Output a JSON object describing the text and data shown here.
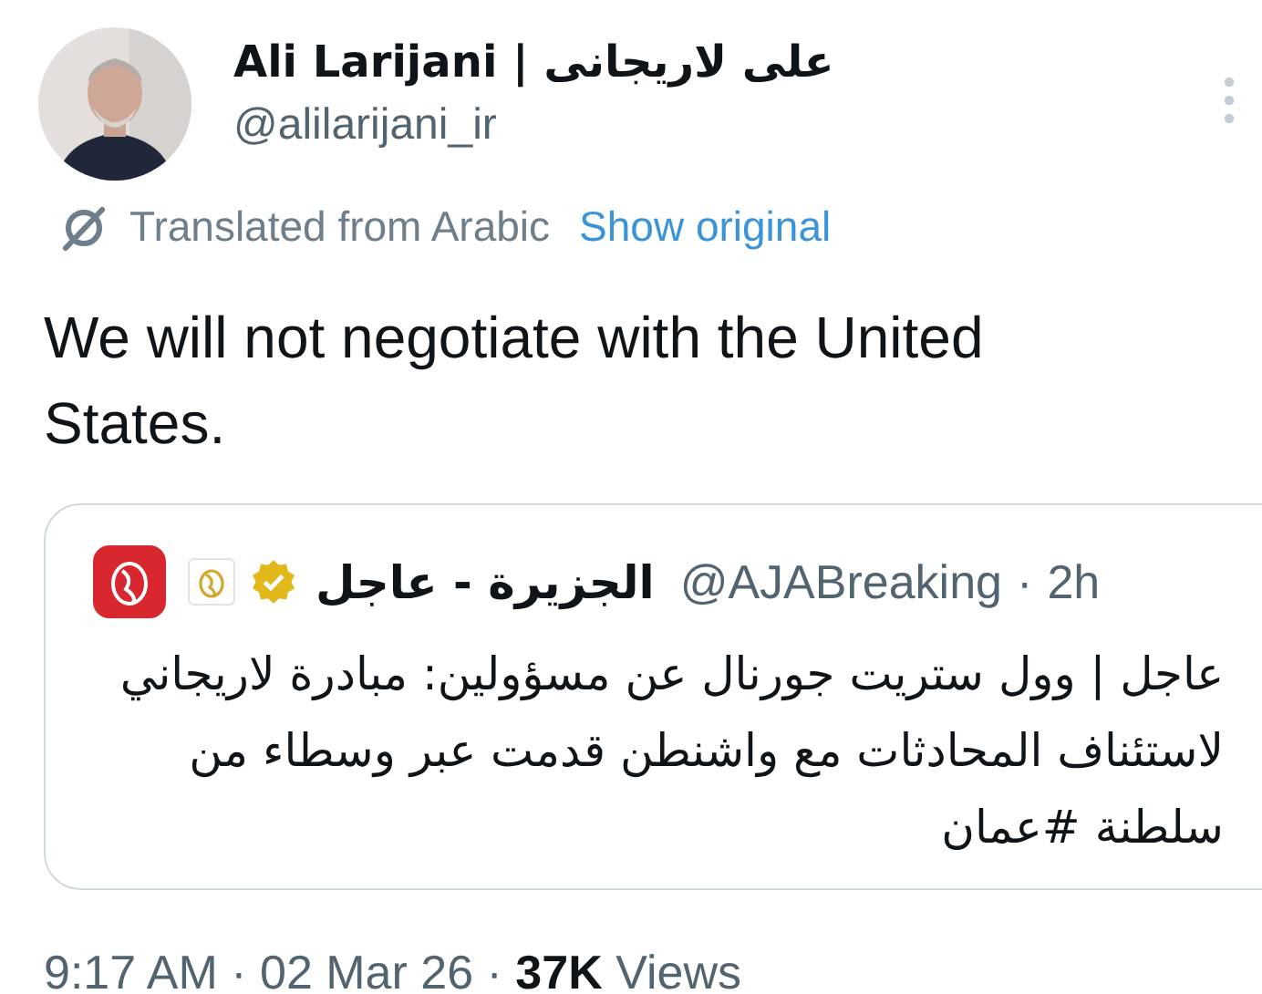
{
  "author": {
    "name": "Ali Larijani | علی لاریجانی",
    "handle": "@alilarijani_ir"
  },
  "translation": {
    "label": "Translated from Arabic",
    "link": "Show original"
  },
  "text": "We will not negotiate with the United States.",
  "quote": {
    "name": "الجزيرة - عاجل",
    "verified": true,
    "handle": "@AJABreaking",
    "separator": "·",
    "time": "2h",
    "text": "عاجل | وول ستريت جورنال عن مسؤولين: مبادرة لاريجاني لاستئناف المحادثات مع واشنطن قدمت عبر وسطاء من سلطنة #عمان"
  },
  "footer": "9:17 AM · 02 Mar 26 · **37K** Views"
}
